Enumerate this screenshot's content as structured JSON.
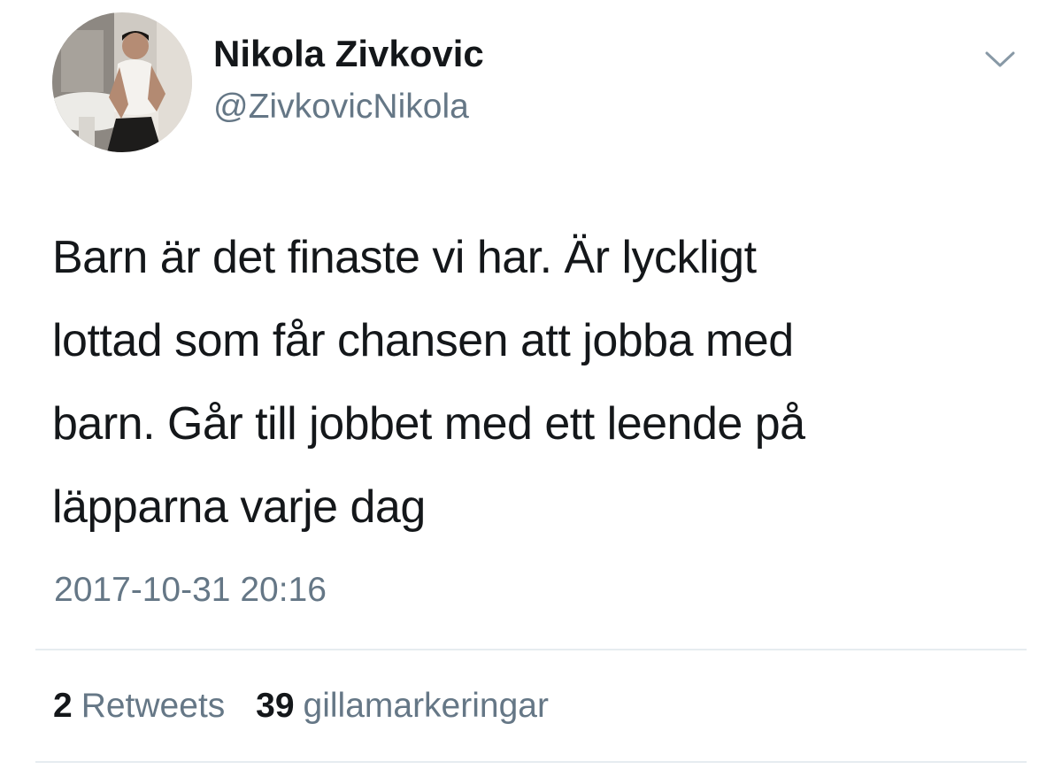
{
  "author": {
    "display_name": "Nikola Zivkovic",
    "handle": "@ZivkovicNikola",
    "avatar_icon": "profile-photo"
  },
  "menu": {
    "icon": "chevron-down-icon"
  },
  "tweet": {
    "text": "Barn är det finaste vi har. Är lyckligt\nlottad som får chansen att jobba med\nbarn. Går till jobbet med ett leende på\nläpparna varje dag",
    "timestamp": "2017-10-31 20:16"
  },
  "stats": {
    "retweets_count": "2",
    "retweets_label": "Retweets",
    "likes_count": "39",
    "likes_label": "gillamarkeringar"
  },
  "colors": {
    "primary_text": "#14171a",
    "secondary_text": "#657786",
    "divider": "#e6ecf0"
  }
}
